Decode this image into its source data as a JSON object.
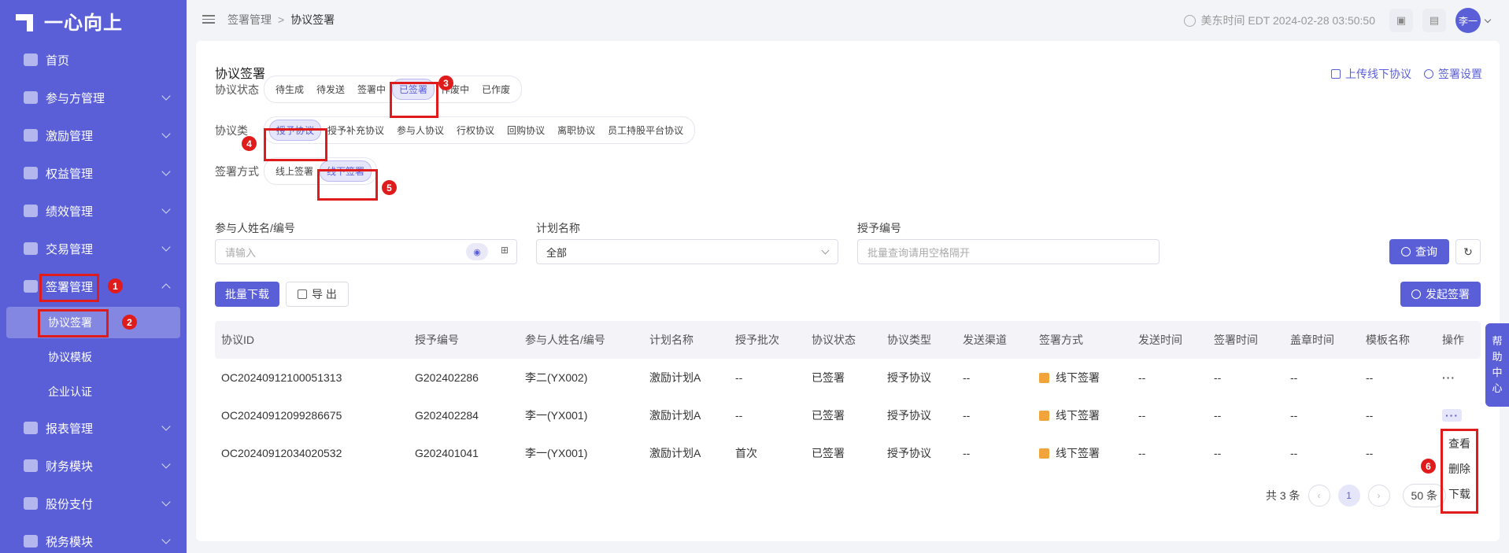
{
  "app": {
    "logo_text": "一心向上"
  },
  "sidebar": {
    "items": [
      {
        "label": "首页"
      },
      {
        "label": "参与方管理"
      },
      {
        "label": "激励管理"
      },
      {
        "label": "权益管理"
      },
      {
        "label": "绩效管理"
      },
      {
        "label": "交易管理"
      },
      {
        "label": "签署管理"
      },
      {
        "label": "报表管理"
      },
      {
        "label": "财务模块"
      },
      {
        "label": "股份支付"
      },
      {
        "label": "税务模块"
      }
    ],
    "sub_items": [
      {
        "label": "协议签署"
      },
      {
        "label": "协议模板"
      },
      {
        "label": "企业认证"
      }
    ]
  },
  "header": {
    "breadcrumb": [
      "签署管理",
      "协议签署"
    ],
    "breadcrumb_sep": ">",
    "timezone": "美东时间 EDT 2024-02-28 03:50:50",
    "avatar": "李一"
  },
  "page": {
    "title": "协议签署",
    "upload_label": "上传线下协议",
    "settings_label": "签署设置"
  },
  "filters": {
    "status": {
      "label": "协议状态",
      "options": [
        "待生成",
        "待发送",
        "签署中",
        "已签署",
        "作废中",
        "已作废"
      ],
      "selected": "已签署"
    },
    "type": {
      "label": "协议类",
      "options": [
        "授予协议",
        "授予补充协议",
        "参与人协议",
        "行权协议",
        "回购协议",
        "离职协议",
        "员工持股平台协议"
      ],
      "selected": "授予协议"
    },
    "method": {
      "label": "签署方式",
      "options": [
        "线上签署",
        "线下签署"
      ],
      "selected": "线下签署"
    }
  },
  "search": {
    "participant_label": "参与人姓名/编号",
    "participant_placeholder": "请输入",
    "plan_label": "计划名称",
    "plan_value": "全部",
    "grant_label": "授予编号",
    "grant_placeholder": "批量查询请用空格隔开",
    "query_label": "查询"
  },
  "actions": {
    "batch_download": "批量下载",
    "export": "导 出",
    "start_sign": "发起签署"
  },
  "table": {
    "headers": [
      "协议ID",
      "授予编号",
      "参与人姓名/编号",
      "计划名称",
      "授予批次",
      "协议状态",
      "协议类型",
      "发送渠道",
      "签署方式",
      "发送时间",
      "签署时间",
      "盖章时间",
      "模板名称",
      "操作"
    ],
    "rows": [
      [
        "OC20240912100051313",
        "G202402286",
        "李二(YX002)",
        "激励计划A",
        "--",
        "已签署",
        "授予协议",
        "--",
        "线下签署",
        "--",
        "--",
        "--",
        "--",
        "···"
      ],
      [
        "OC20240912099286675",
        "G202402284",
        "李一(YX001)",
        "激励计划A",
        "--",
        "已签署",
        "授予协议",
        "--",
        "线下签署",
        "--",
        "--",
        "--",
        "--",
        "···"
      ],
      [
        "OC20240912034020532",
        "G202401041",
        "李一(YX001)",
        "激励计划A",
        "首次",
        "已签署",
        "授予协议",
        "--",
        "线下签署",
        "--",
        "--",
        "--",
        "--",
        ""
      ]
    ]
  },
  "row_menu": [
    "查看",
    "删除",
    "下载"
  ],
  "pagination": {
    "total": "共 3 条",
    "current": "1",
    "page_size": "50 条"
  },
  "help": {
    "label": [
      "帮",
      "助",
      "中",
      "心"
    ]
  },
  "annotations": [
    "1",
    "2",
    "3",
    "4",
    "5",
    "6"
  ],
  "colors": {
    "accent": "#5a5fd8",
    "annotation_red": "#e01b1b"
  }
}
